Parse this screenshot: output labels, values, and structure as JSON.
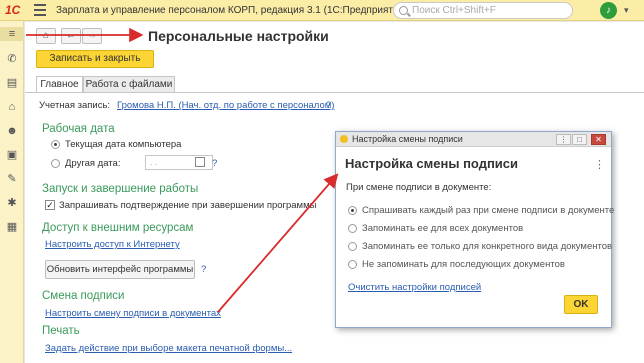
{
  "titlebar": {
    "logo": "1С",
    "title": "Зарплата и управление персоналом КОРП, редакция 3.1  (1С:Предприятие)",
    "search_placeholder": "Поиск Ctrl+Shift+F"
  },
  "sidebar": {
    "icons": [
      "menu-icon",
      "phone-icon",
      "document-icon",
      "graduation-icon",
      "users-icon",
      "wallet-icon",
      "wrench-icon",
      "gear-icon",
      "table-icon"
    ]
  },
  "form": {
    "title": "Персональные настройки",
    "save_close": "Записать и закрыть",
    "tabs": [
      "Главное",
      "Работа с файлами"
    ],
    "account_label": "Учетная запись:",
    "account_value": "Громова Н.П. (Нач. отд. по работе с персоналом)",
    "work_date": {
      "heading": "Рабочая дата",
      "option1": "Текущая дата компьютера",
      "option2": "Другая дата:",
      "date_placeholder": ". .",
      "selected": "option1"
    },
    "startup": {
      "heading": "Запуск и завершение работы",
      "confirm_exit": "Запрашивать подтверждение при завершении программы",
      "confirm_exit_checked": true
    },
    "internet": {
      "heading": "Доступ к внешним ресурсам",
      "link": "Настроить доступ к Интернету",
      "update_button": "Обновить интерфейс программы"
    },
    "signature": {
      "heading": "Смена подписи",
      "link": "Настроить смену подписи в документах"
    },
    "print": {
      "heading": "Печать",
      "link": "Задать действие при выборе макета печатной формы..."
    },
    "help": "?"
  },
  "dialog": {
    "window_title": "Настройка смены подписи",
    "title": "Настройка смены подписи",
    "prompt": "При смене подписи в документе:",
    "options": [
      "Спрашивать каждый раз при смене подписи в документе",
      "Запоминать ее для всех документов",
      "Запоминать ее только для конкретного вида документов",
      "Не запоминать для последующих документов"
    ],
    "selected_option": 0,
    "clear_link": "Очистить настройки подписей",
    "ok": "OK"
  },
  "colors": {
    "titlebar": "#fbeda6",
    "accent_yellow": "#fcd434",
    "section_green": "#3a9a5b",
    "link_blue": "#2a5db0",
    "annotation_red": "#d92b2b"
  }
}
